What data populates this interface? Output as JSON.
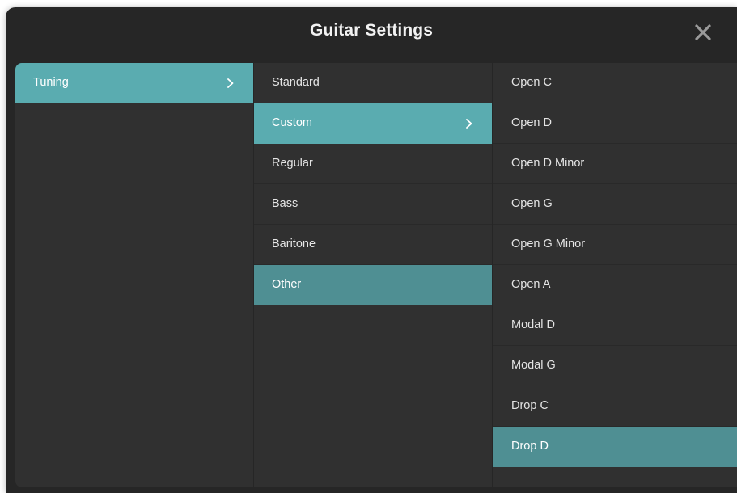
{
  "dialog": {
    "title": "Guitar Settings",
    "close_icon": "close-icon"
  },
  "columns": {
    "category": {
      "items": [
        {
          "label": "Tuning",
          "state": "selected",
          "has_submenu": true
        }
      ]
    },
    "tuning_type": {
      "items": [
        {
          "label": "Standard",
          "state": "normal"
        },
        {
          "label": "Custom",
          "state": "selected",
          "has_submenu": true
        },
        {
          "label": "Regular",
          "state": "normal"
        },
        {
          "label": "Bass",
          "state": "normal"
        },
        {
          "label": "Baritone",
          "state": "normal"
        },
        {
          "label": "Other",
          "state": "highlighted"
        }
      ]
    },
    "custom_tunings": {
      "items": [
        {
          "label": "Open C",
          "state": "normal"
        },
        {
          "label": "Open D",
          "state": "normal"
        },
        {
          "label": "Open D Minor",
          "state": "normal"
        },
        {
          "label": "Open G",
          "state": "normal"
        },
        {
          "label": "Open G Minor",
          "state": "normal"
        },
        {
          "label": "Open A",
          "state": "normal"
        },
        {
          "label": "Modal D",
          "state": "normal"
        },
        {
          "label": "Modal G",
          "state": "normal"
        },
        {
          "label": "Drop C",
          "state": "normal"
        },
        {
          "label": "Drop D",
          "state": "highlighted"
        }
      ]
    }
  },
  "colors": {
    "accent": "#5aacb0",
    "accent_dim": "#4f8f93",
    "window_bg": "#262626",
    "panel_bg": "#303030",
    "text": "#e4e4e4"
  }
}
